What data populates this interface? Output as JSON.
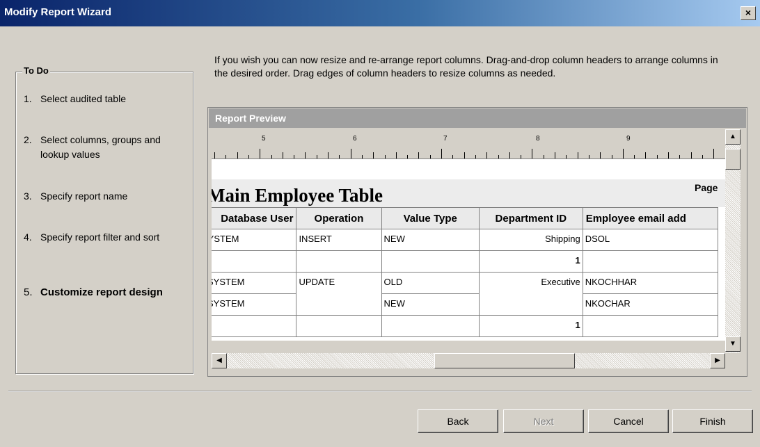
{
  "window": {
    "title": "Modify Report Wizard",
    "close_glyph": "×"
  },
  "todo": {
    "legend": "To Do",
    "items": [
      {
        "num": "1.",
        "label": "Select audited table"
      },
      {
        "num": "2.",
        "label": "Select columns, groups and lookup values"
      },
      {
        "num": "3.",
        "label": "Specify report name"
      },
      {
        "num": "4.",
        "label": "Specify report filter and sort"
      },
      {
        "num": "5.",
        "label": "Customize report design"
      }
    ]
  },
  "instruction": "If you wish you can now resize and re-arrange report columns. Drag-and-drop column headers to arrange columns in the desired order.   Drag edges of column headers to resize columns as needed.",
  "preview": {
    "title": "Report Preview",
    "ruler_numbers": [
      "5",
      "6",
      "7",
      "8",
      "9"
    ],
    "report_title": "Main Employee Table",
    "page_label": "Page",
    "columns": [
      "Database User",
      "Operation",
      "Value Type",
      "Department ID",
      "Employee email add"
    ],
    "rows": [
      [
        "SYSTEM",
        "INSERT",
        "NEW",
        "Shipping",
        "DSOL"
      ],
      [
        "",
        "",
        "",
        "1",
        ""
      ],
      [
        "SYSTEM",
        "UPDATE",
        "OLD",
        "Executive",
        "NKOCHHAR"
      ],
      [
        "SYSTEM",
        "",
        "NEW",
        "",
        "NKOCHAR"
      ],
      [
        "",
        "",
        "",
        "1",
        ""
      ]
    ]
  },
  "scrollbars": {
    "up_icon": "▲",
    "down_icon": "▼",
    "left_icon": "◀",
    "right_icon": "▶"
  },
  "buttons": {
    "back": "Back",
    "next": "Next",
    "cancel": "Cancel",
    "finish": "Finish"
  }
}
